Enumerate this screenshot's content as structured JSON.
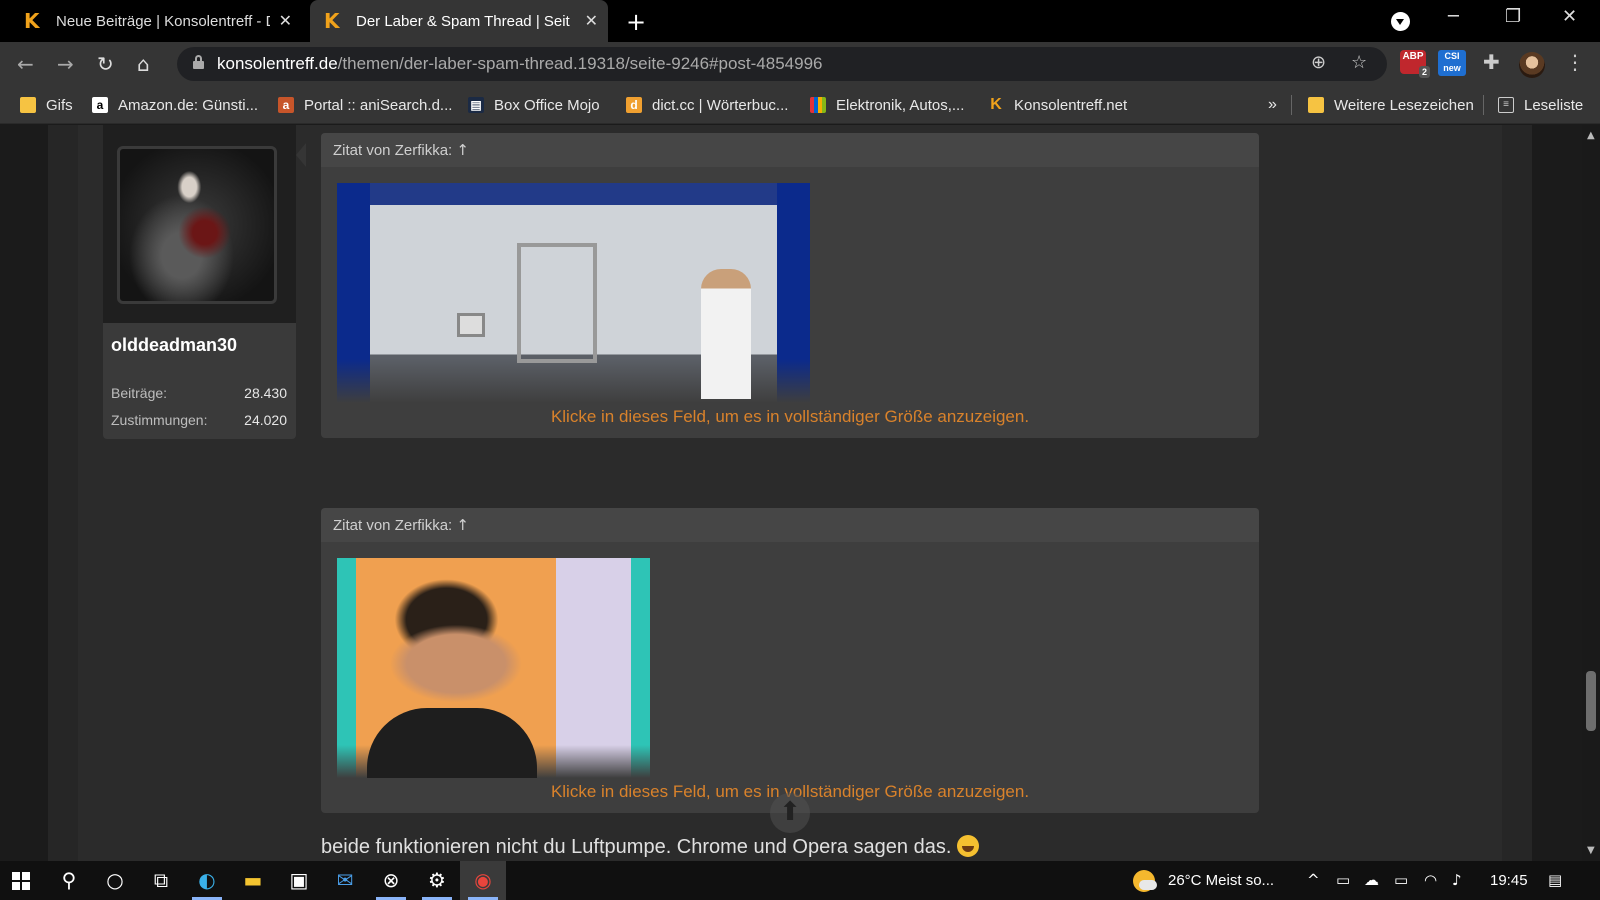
{
  "tabs": [
    {
      "title": "Neue Beiträge | Konsolentreff - D",
      "close": "✕"
    },
    {
      "title": "Der Laber & Spam Thread | Seite",
      "close": "✕"
    }
  ],
  "tab_new": "+",
  "window_controls": {
    "minimize": "─",
    "restore": "❐",
    "close": "✕"
  },
  "nav": {
    "back": "←",
    "forward": "→",
    "reload": "↻",
    "home": "⌂"
  },
  "address": {
    "host": "konsolentreff.de",
    "path": "/themen/der-laber-spam-thread.19318/seite-9246#post-4854996"
  },
  "toolbar_icons": {
    "zoom": "⊕",
    "star": "☆",
    "puzzle": "✚",
    "kebab": "⋮"
  },
  "extensions": {
    "abp": {
      "label": "ABP",
      "count": "2"
    },
    "csi": {
      "label": "CSI",
      "badge": "new"
    }
  },
  "bookmarks": [
    {
      "label": "Gifs",
      "icon": "folder"
    },
    {
      "label": "Amazon.de: Günsti...",
      "icon": "amazon-icon"
    },
    {
      "label": "Portal :: aniSearch.d...",
      "icon": "anisearch-icon"
    },
    {
      "label": "Box Office Mojo",
      "icon": "boxofficemojo-icon"
    },
    {
      "label": "dict.cc | Wörterbuc...",
      "icon": "dictcc-icon"
    },
    {
      "label": "Elektronik, Autos,...",
      "icon": "ebay-icon"
    },
    {
      "label": "Konsolentreff.net",
      "icon": "konsolentreff-icon"
    }
  ],
  "bookmarks_overflow": "»",
  "bookmarks_other": "Weitere Lesezeichen",
  "reading_list": "Leseliste",
  "user": {
    "name": "olddeadman30",
    "stats": [
      {
        "label": "Beiträge:",
        "value": "28.430"
      },
      {
        "label": "Zustimmungen:",
        "value": "24.020"
      }
    ]
  },
  "quotes": [
    {
      "header": "Zitat von Zerfikka:",
      "arrow": "↑",
      "expand": "Klicke in dieses Feld, um es in vollständiger Größe anzuzeigen."
    },
    {
      "header": "Zitat von Zerfikka:",
      "arrow": "↑",
      "expand": "Klicke in dieses Feld, um es in vollständiger Größe anzuzeigen."
    }
  ],
  "post_text": "beide funktionieren nicht du Luftpumpe. Chrome und Opera sagen das.",
  "scroll_top_arrow": "⬆",
  "taskbar": {
    "weather": "26°C  Meist so...",
    "time": "19:45",
    "tray_chevron": "^"
  },
  "colors": {
    "accent_orange": "#d9822b",
    "page_bg": "#2b2b2b",
    "quote_bg": "#3e3e3e",
    "chrome_bg": "#353535"
  }
}
